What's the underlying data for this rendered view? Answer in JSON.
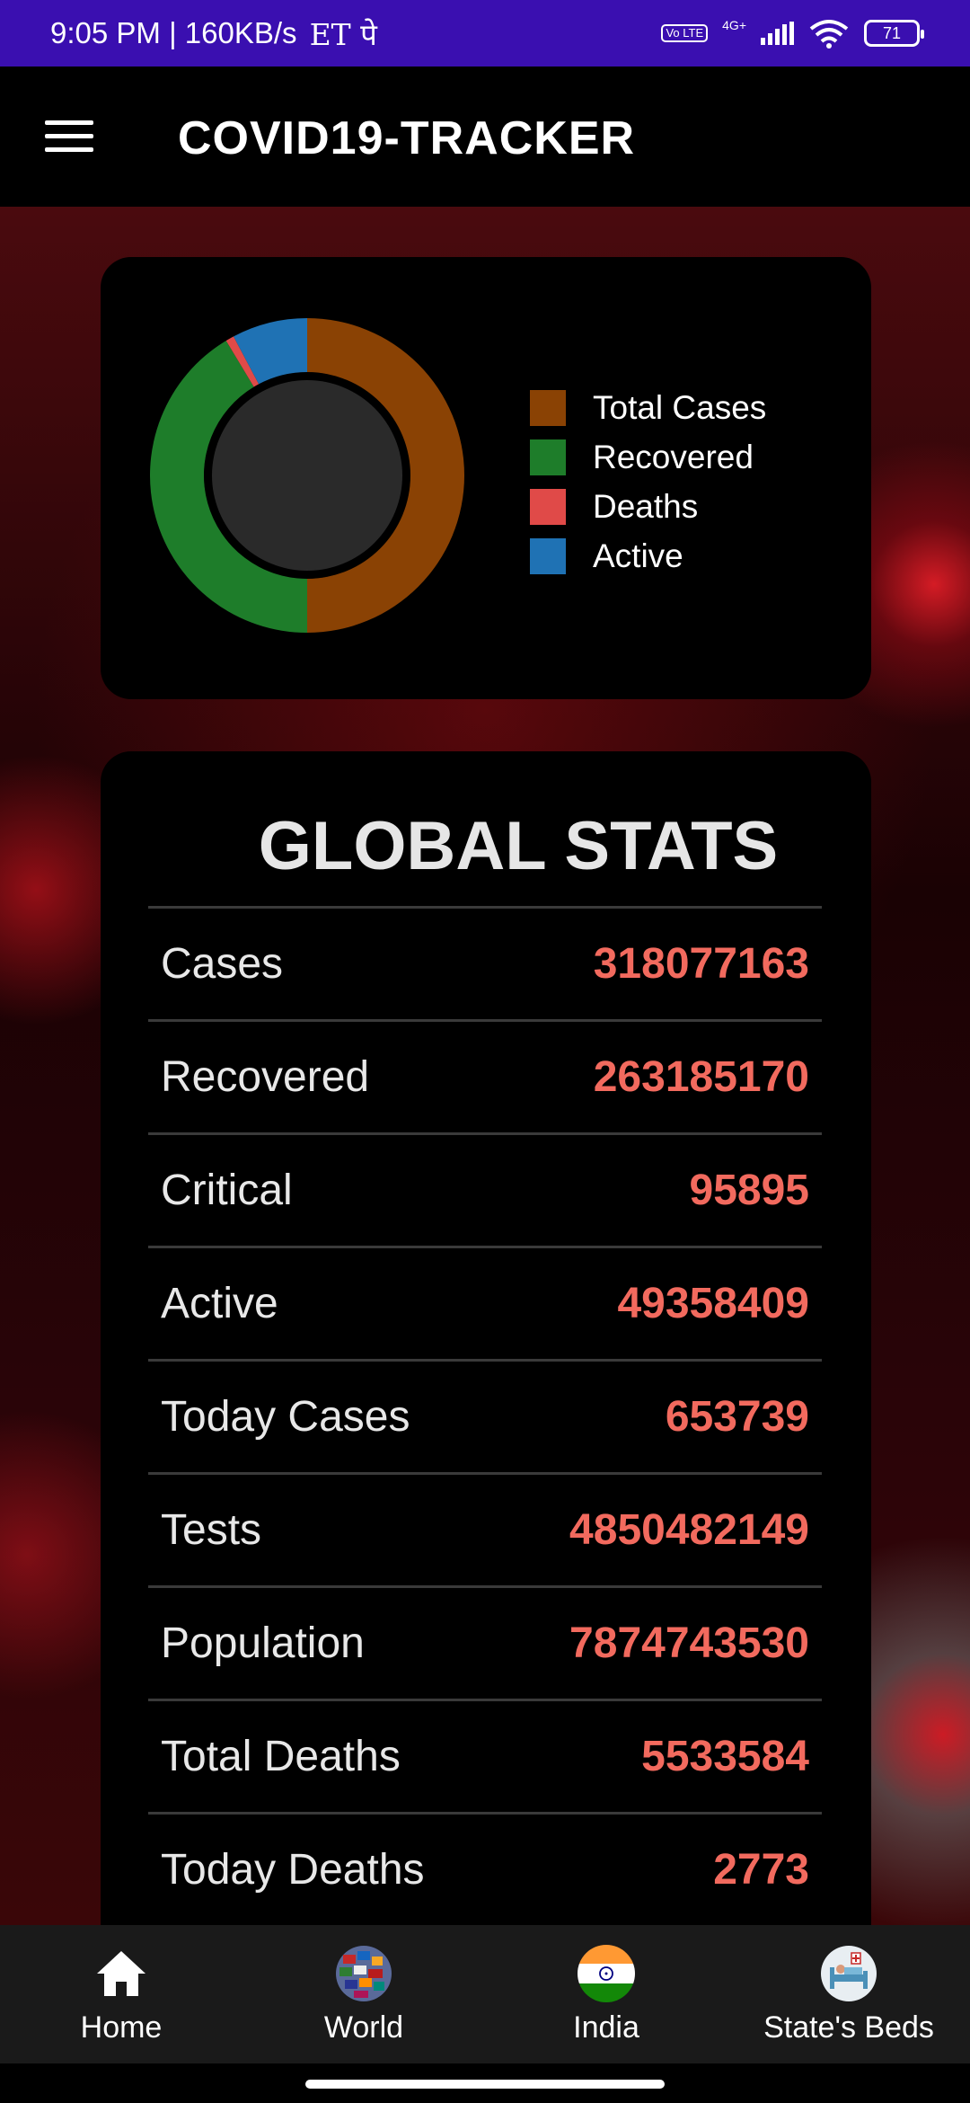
{
  "status_bar": {
    "time_and_speed": "9:05 PM | 160KB/s",
    "app_marks": "ET पे",
    "network": "4G+",
    "volte": "Vo LTE",
    "battery": "71"
  },
  "app_bar": {
    "title": "COVID19-TRACKER",
    "menu_icon": "hamburger-menu-icon"
  },
  "chart_data": {
    "type": "pie",
    "style": "donut",
    "labels": [
      "Total Cases",
      "Recovered",
      "Deaths",
      "Active"
    ],
    "values": [
      318077163,
      263185170,
      5533584,
      49358409
    ],
    "colors": [
      "#8a4204",
      "#1e7d2a",
      "#e04a48",
      "#1f72b4"
    ],
    "legend_position": "right"
  },
  "stats": {
    "title": "GLOBAL STATS",
    "rows": [
      {
        "label": "Cases",
        "value": "318077163"
      },
      {
        "label": "Recovered",
        "value": "263185170"
      },
      {
        "label": "Critical",
        "value": "95895"
      },
      {
        "label": "Active",
        "value": "49358409"
      },
      {
        "label": "Today Cases",
        "value": "653739"
      },
      {
        "label": "Tests",
        "value": "4850482149"
      },
      {
        "label": "Population",
        "value": "7874743530"
      },
      {
        "label": "Total Deaths",
        "value": "5533584"
      },
      {
        "label": "Today Deaths",
        "value": "2773"
      }
    ]
  },
  "nav": {
    "items": [
      {
        "label": "Home",
        "icon": "home-icon"
      },
      {
        "label": "World",
        "icon": "globe-flags-icon"
      },
      {
        "label": "India",
        "icon": "india-flag-icon"
      },
      {
        "label": "State's Beds",
        "icon": "hospital-bed-icon"
      }
    ]
  },
  "colors": {
    "status_bar": "#3a0fb0",
    "value_text": "#f26a5e",
    "nav_bg": "#1a1a1a"
  }
}
